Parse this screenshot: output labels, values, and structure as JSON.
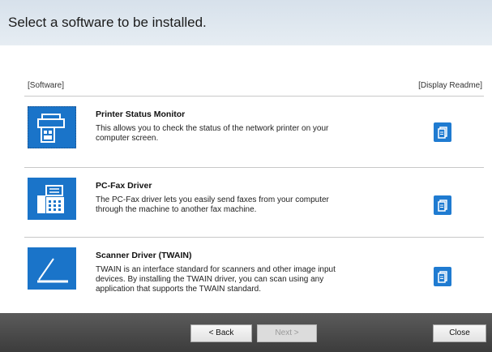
{
  "header": {
    "title": "Select a software to be installed."
  },
  "columns": {
    "software": "[Software]",
    "readme": "[Display Readme]"
  },
  "items": [
    {
      "title": "Printer Status Monitor",
      "description": "This allows you to check the status of the network printer on your\ncomputer screen.",
      "icon": "printer-status-icon"
    },
    {
      "title": "PC-Fax Driver",
      "description": "The PC-Fax driver lets you easily send faxes from your computer\nthrough the machine to another fax machine.",
      "icon": "fax-machine-icon"
    },
    {
      "title": "Scanner Driver (TWAIN)",
      "description": "TWAIN is an interface standard for scanners and other image input\ndevices. By installing the TWAIN driver, you can scan using any\napplication that supports the TWAIN standard.",
      "icon": "scanner-icon"
    }
  ],
  "buttons": {
    "back": "< Back",
    "next": "Next >",
    "close": "Close"
  },
  "colors": {
    "accent": "#1a74c9",
    "footer": "#4a4a4a"
  }
}
